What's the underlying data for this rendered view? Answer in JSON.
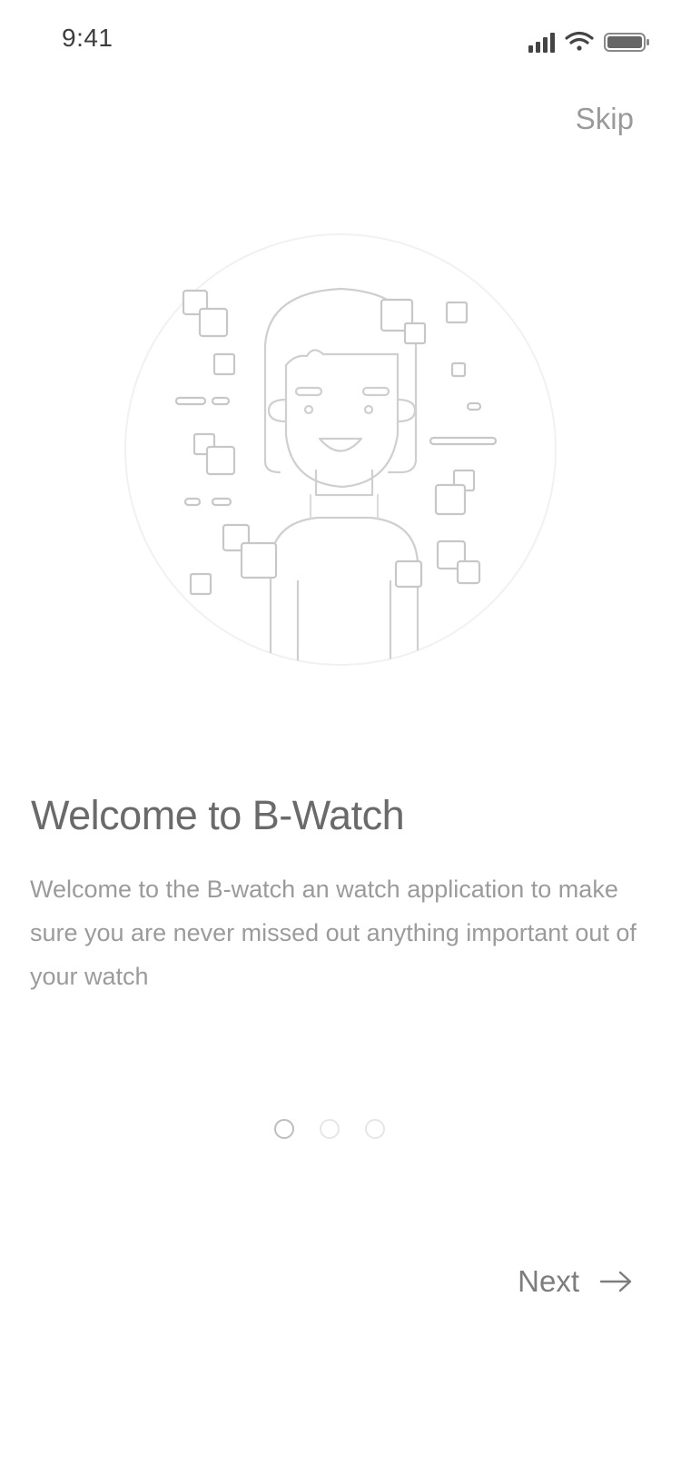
{
  "status_bar": {
    "time": "9:41"
  },
  "header": {
    "skip_label": "Skip"
  },
  "onboarding": {
    "title": "Welcome to B-Watch",
    "description": "Welcome to the B-watch an watch application to make sure you are never missed out anything important out of your watch",
    "pager": {
      "total": 3,
      "active": 1
    }
  },
  "footer": {
    "next_label": "Next"
  },
  "icons": {
    "signal": "cellular-signal-icon",
    "wifi": "wifi-icon",
    "battery": "battery-icon",
    "next": "arrow-right-icon"
  },
  "colors": {
    "text_dark": "#6a6a6a",
    "text_light": "#9b9b9b",
    "line": "#c9c9c9"
  }
}
